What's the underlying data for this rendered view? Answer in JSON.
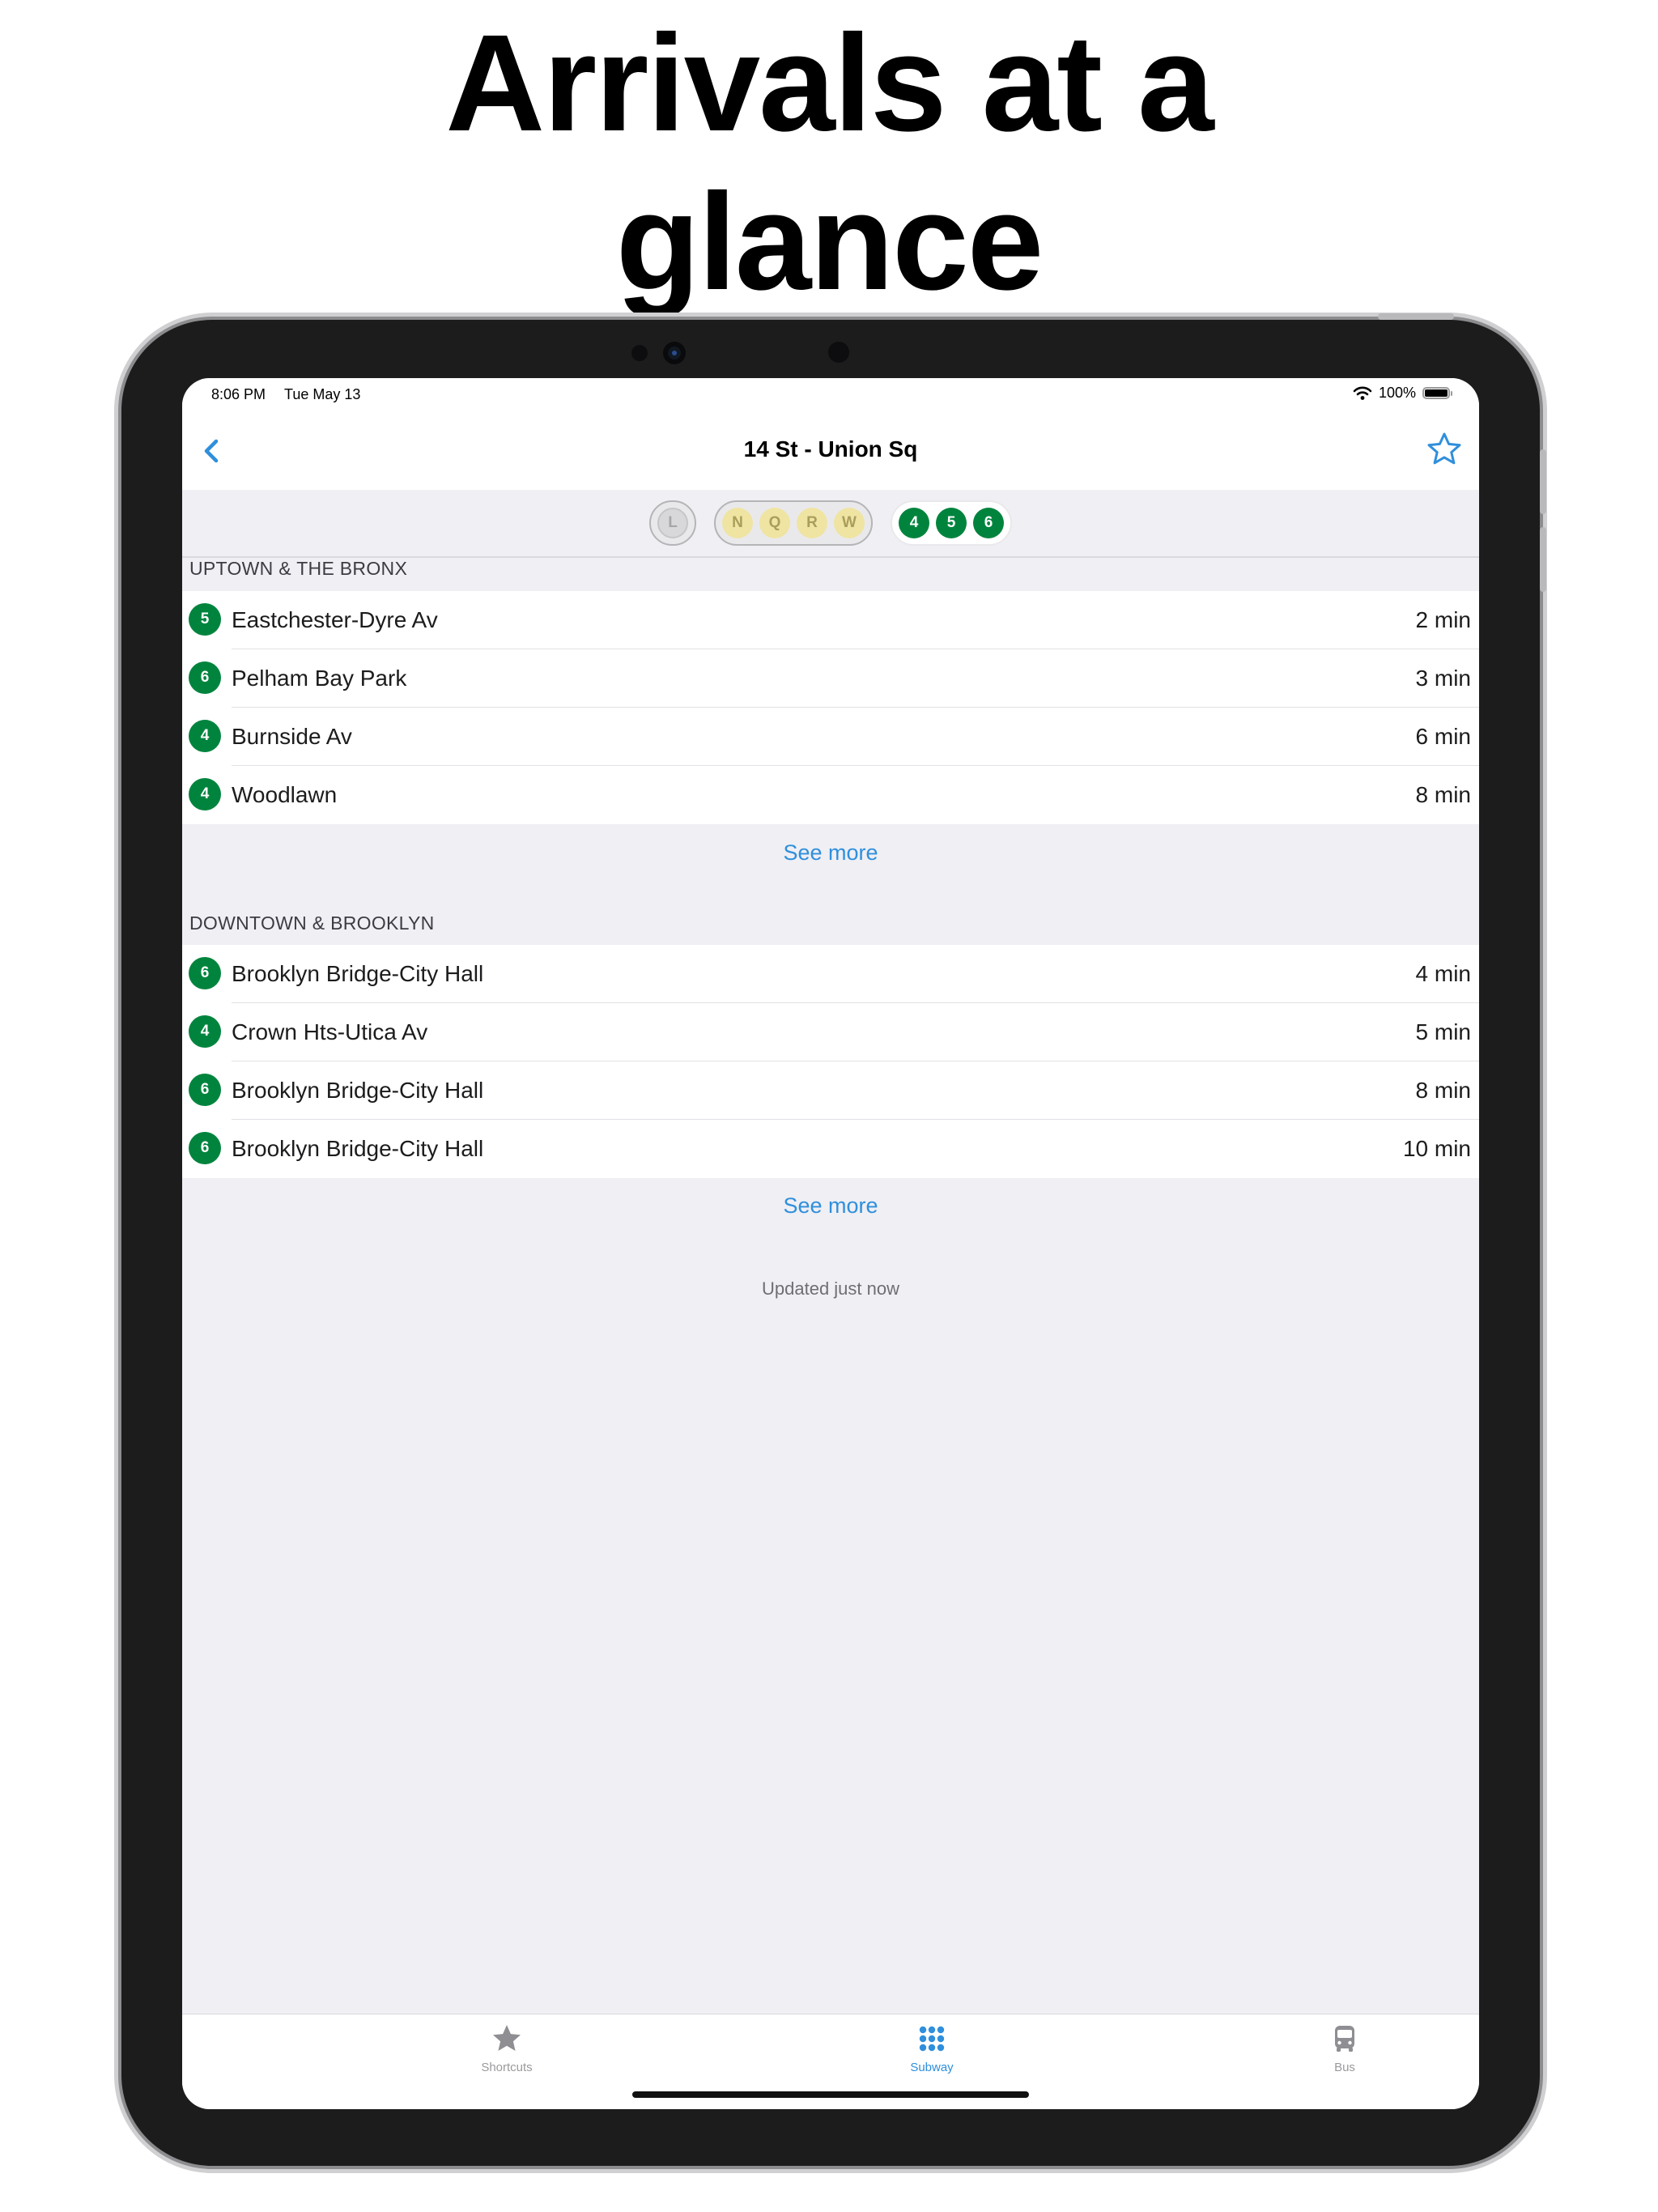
{
  "headline": [
    "Arrivals at a",
    "glance"
  ],
  "status_bar": {
    "time": "8:06 PM",
    "date": "Tue May 13",
    "battery": "100%"
  },
  "navbar": {
    "title": "14 St - Union Sq"
  },
  "line_groups": [
    {
      "state": "dim",
      "lines": [
        {
          "label": "L",
          "bg": "#d8d8da",
          "fg": "#a6a6a9"
        }
      ]
    },
    {
      "state": "dim",
      "lines": [
        {
          "label": "N",
          "bg": "#efe4a2",
          "fg": "#a99e5b"
        },
        {
          "label": "Q",
          "bg": "#efe4a2",
          "fg": "#a99e5b"
        },
        {
          "label": "R",
          "bg": "#efe4a2",
          "fg": "#a99e5b"
        },
        {
          "label": "W",
          "bg": "#efe4a2",
          "fg": "#a99e5b"
        }
      ]
    },
    {
      "state": "active",
      "lines": [
        {
          "label": "4",
          "bg": "#00843d",
          "fg": "#ffffff"
        },
        {
          "label": "5",
          "bg": "#00843d",
          "fg": "#ffffff"
        },
        {
          "label": "6",
          "bg": "#00843d",
          "fg": "#ffffff"
        }
      ]
    }
  ],
  "sections": [
    {
      "header": "UPTOWN & THE BRONX",
      "rows": [
        {
          "line": "5",
          "destination": "Eastchester-Dyre Av",
          "eta": "2 min"
        },
        {
          "line": "6",
          "destination": "Pelham Bay Park",
          "eta": "3 min"
        },
        {
          "line": "4",
          "destination": "Burnside Av",
          "eta": "6 min"
        },
        {
          "line": "4",
          "destination": "Woodlawn",
          "eta": "8 min"
        }
      ],
      "see_more": "See more"
    },
    {
      "header": "DOWNTOWN & BROOKLYN",
      "rows": [
        {
          "line": "6",
          "destination": "Brooklyn Bridge-City Hall",
          "eta": "4 min"
        },
        {
          "line": "4",
          "destination": "Crown Hts-Utica Av",
          "eta": "5 min"
        },
        {
          "line": "6",
          "destination": "Brooklyn Bridge-City Hall",
          "eta": "8 min"
        },
        {
          "line": "6",
          "destination": "Brooklyn Bridge-City Hall",
          "eta": "10 min"
        }
      ],
      "see_more": "See more"
    }
  ],
  "updated_text": "Updated just now",
  "tabs": [
    {
      "label": "Shortcuts",
      "icon": "star-icon",
      "active": false
    },
    {
      "label": "Subway",
      "icon": "grid-dots-icon",
      "active": true
    },
    {
      "label": "Bus",
      "icon": "bus-icon",
      "active": false
    }
  ],
  "colors": {
    "accent": "#2f8fdc",
    "route_456": "#00843d",
    "background": "#efeff4"
  }
}
